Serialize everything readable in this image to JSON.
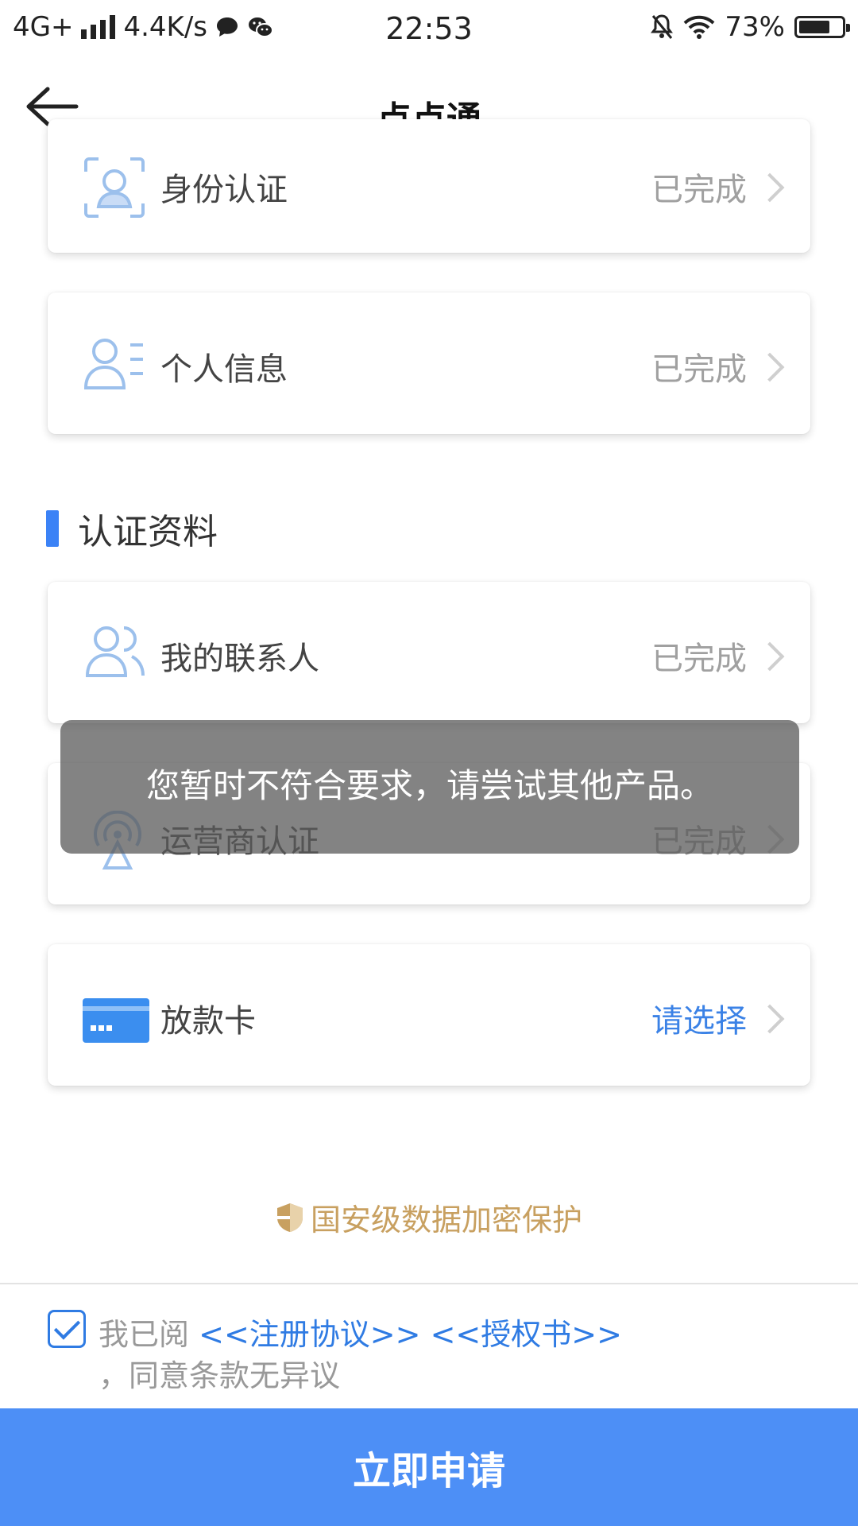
{
  "statusbar": {
    "network": "4G+",
    "speed": "4.4K/s",
    "time": "22:53",
    "battery_text": "73%",
    "battery_level": 0.73
  },
  "header": {
    "title": "点点通"
  },
  "cards": [
    {
      "label": "身份认证",
      "status": "已完成",
      "icon": "face-id-icon"
    },
    {
      "label": "个人信息",
      "status": "已完成",
      "icon": "person-list-icon"
    },
    {
      "label": "我的联系人",
      "status": "已完成",
      "icon": "contacts-icon"
    },
    {
      "label": "运营商认证",
      "status": "已完成",
      "icon": "antenna-icon"
    },
    {
      "label": "放款卡",
      "status": "请选择",
      "icon": "card-icon"
    }
  ],
  "section": {
    "title": "认证资料"
  },
  "toast": {
    "text": "您暂时不符合要求，请尝试其他产品。"
  },
  "secure": {
    "text": "国安级数据加密保护"
  },
  "agreement": {
    "prefix": "我已阅",
    "link1": "<<注册协议>>",
    "link2": "<<授权书>>",
    "suffix": "，同意条款无异议",
    "checked": true
  },
  "apply_button": {
    "label": "立即申请"
  },
  "colors": {
    "accent": "#4d8ff6",
    "link": "#2f7be3",
    "secure": "#c8a060"
  }
}
